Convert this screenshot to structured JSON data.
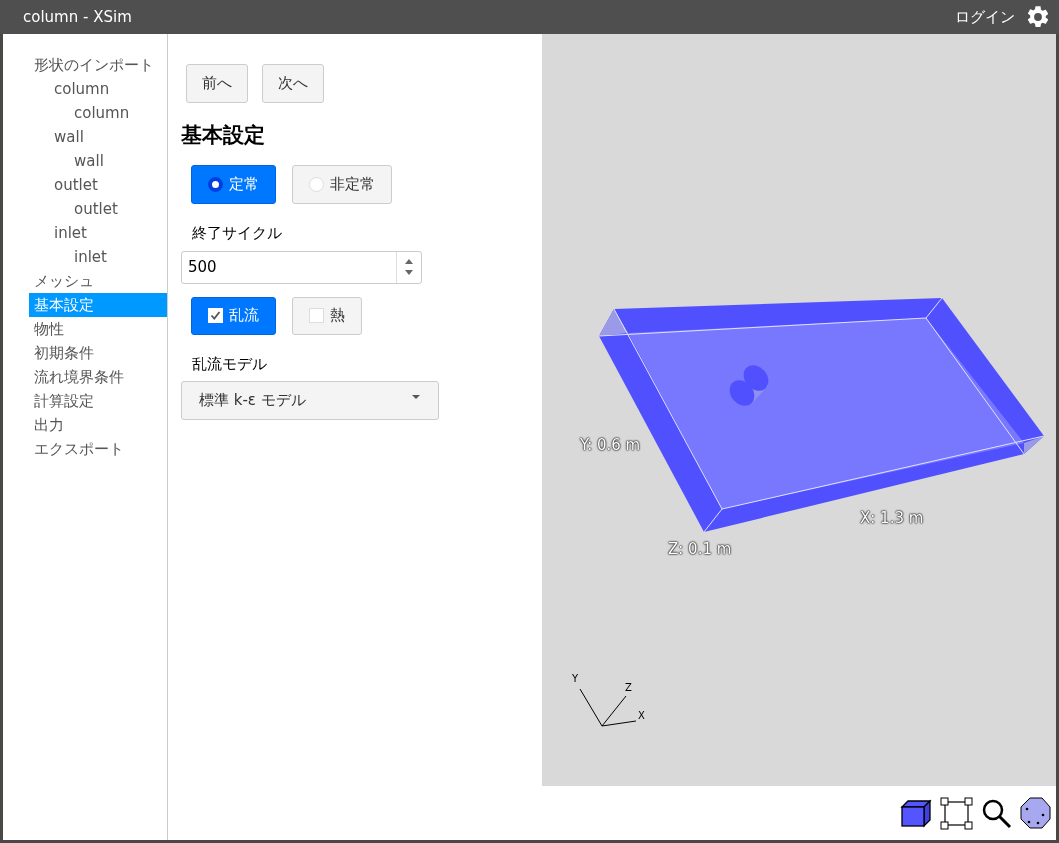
{
  "window": {
    "title": "column - XSim"
  },
  "header": {
    "login": "ログイン"
  },
  "sidebar": {
    "items": [
      {
        "label": "形状のインポート",
        "selected": false,
        "children": [
          {
            "label": "column",
            "selected": false,
            "children": [
              {
                "label": "column",
                "selected": false
              }
            ]
          },
          {
            "label": "wall",
            "selected": false,
            "children": [
              {
                "label": "wall",
                "selected": false
              }
            ]
          },
          {
            "label": "outlet",
            "selected": false,
            "children": [
              {
                "label": "outlet",
                "selected": false
              }
            ]
          },
          {
            "label": "inlet",
            "selected": false,
            "children": [
              {
                "label": "inlet",
                "selected": false
              }
            ]
          }
        ]
      },
      {
        "label": "メッシュ",
        "selected": false
      },
      {
        "label": "基本設定",
        "selected": true
      },
      {
        "label": "物性",
        "selected": false
      },
      {
        "label": "初期条件",
        "selected": false
      },
      {
        "label": "流れ境界条件",
        "selected": false
      },
      {
        "label": "計算設定",
        "selected": false
      },
      {
        "label": "出力",
        "selected": false
      },
      {
        "label": "エクスポート",
        "selected": false
      }
    ]
  },
  "nav_buttons": [
    "前へ",
    "次へ"
  ],
  "heading": "基本設定",
  "time_mode": [
    {
      "label": "定常",
      "selected": true
    },
    {
      "label": "非定常",
      "selected": false
    }
  ],
  "end_cycle": {
    "label": "終了サイクル",
    "value": "500"
  },
  "toggles": [
    {
      "label": "乱流",
      "checked": true
    },
    {
      "label": "熱",
      "checked": false
    }
  ],
  "turbulence_model": {
    "label": "乱流モデル",
    "value": "標準 k-ε モデル"
  },
  "viewport": {
    "dimension_labels": [
      "Y: 0.6 m",
      "X: 1.3 m",
      "Z: 0.1 m"
    ],
    "axes": [
      "Y",
      "Z",
      "X"
    ]
  }
}
